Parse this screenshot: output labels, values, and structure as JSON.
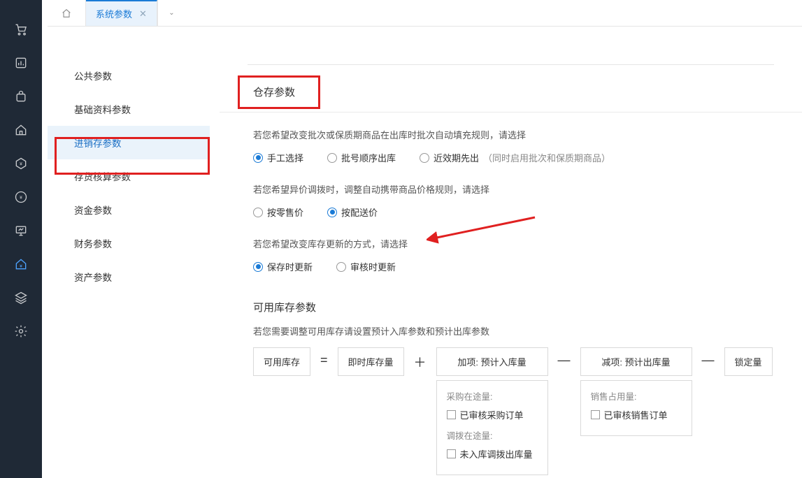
{
  "tabs": {
    "active_label": "系统参数"
  },
  "left_menu": {
    "items": [
      "公共参数",
      "基础资料参数",
      "进销存参数",
      "存货核算参数",
      "资金参数",
      "财务参数",
      "资产参数"
    ],
    "active_index": 2
  },
  "content": {
    "section_title": "仓存参数",
    "batch_rule": {
      "label": "若您希望改变批次或保质期商品在出库时批次自动填充规则，请选择",
      "options": [
        {
          "text": "手工选择",
          "checked": true
        },
        {
          "text": "批号顺序出库",
          "checked": false
        },
        {
          "text": "近效期先出",
          "checked": false,
          "hint": "（同时启用批次和保质期商品）"
        }
      ]
    },
    "price_rule": {
      "label": "若您希望异价调拨时，调整自动携带商品价格规则，请选择",
      "options": [
        {
          "text": "按零售价",
          "checked": false
        },
        {
          "text": "按配送价",
          "checked": true
        }
      ]
    },
    "stock_update": {
      "label": "若您希望改变库存更新的方式，请选择",
      "options": [
        {
          "text": "保存时更新",
          "checked": true
        },
        {
          "text": "审核时更新",
          "checked": false
        }
      ]
    },
    "available": {
      "section_sub": "可用库存参数",
      "hint": "若您需要调整可用库存请设置预计入库参数和预计出库参数",
      "formula": {
        "lhs": "可用库存",
        "eq": "=",
        "base": "即时库存量",
        "plus": "＋",
        "add_col": {
          "head": "加项: 预计入库量",
          "group1_label": "采购在途量:",
          "group1_item": "已审核采购订单",
          "group2_label": "调拨在途量:",
          "group2_item": "未入库调拨出库量"
        },
        "minus1": "—",
        "sub_col": {
          "head": "减项: 预计出库量",
          "group1_label": "销售占用量:",
          "group1_item": "已审核销售订单"
        },
        "minus2": "—",
        "lock": "锁定量"
      }
    }
  }
}
